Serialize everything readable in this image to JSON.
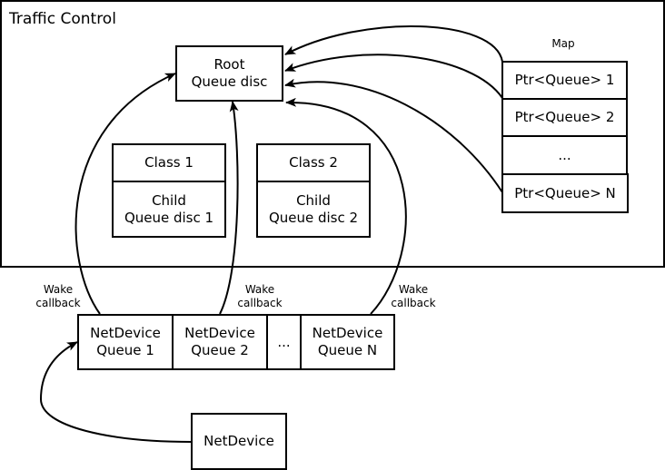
{
  "title": "Traffic Control",
  "root": {
    "line1": "Root",
    "line2": "Queue disc"
  },
  "classes": [
    {
      "label": "Class 1",
      "child_line1": "Child",
      "child_line2": "Queue disc 1"
    },
    {
      "label": "Class 2",
      "child_line1": "Child",
      "child_line2": "Queue disc 2"
    }
  ],
  "map": {
    "label": "Map",
    "entries": [
      "Ptr<Queue> 1",
      "Ptr<Queue> 2",
      "...",
      "Ptr<Queue> N"
    ]
  },
  "netdevice_queues": [
    {
      "line1": "NetDevice",
      "line2": "Queue 1"
    },
    {
      "line1": "NetDevice",
      "line2": "Queue 2"
    },
    {
      "line1": "...",
      "line2": ""
    },
    {
      "line1": "NetDevice",
      "line2": "Queue N"
    }
  ],
  "wake_callback": {
    "line1": "Wake",
    "line2": "callback"
  },
  "netdevice": "NetDevice"
}
